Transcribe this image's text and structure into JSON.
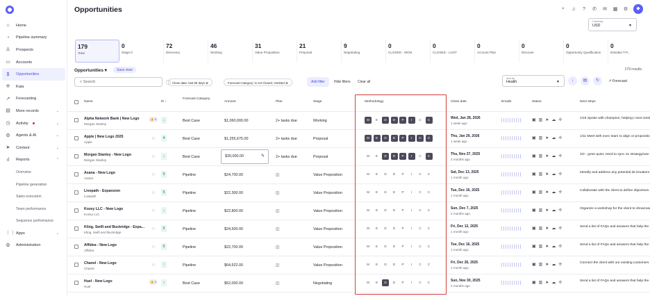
{
  "app": {
    "title": "Opportunities"
  },
  "sidebar": {
    "items": [
      {
        "label": "Home",
        "icon": "home-icon",
        "glyph": "⌂",
        "chev": ""
      },
      {
        "label": "Pipeline summary",
        "icon": "pipeline-icon",
        "glyph": "◔",
        "chev": ""
      },
      {
        "label": "Prospects",
        "icon": "person-icon",
        "glyph": "♙",
        "chev": ""
      },
      {
        "label": "Accounts",
        "icon": "building-icon",
        "glyph": "▭",
        "chev": ""
      },
      {
        "label": "Opportunities",
        "icon": "dollar-icon",
        "glyph": "$",
        "chev": "",
        "active": true
      },
      {
        "label": "Kaia",
        "icon": "kaia-icon",
        "glyph": "✢",
        "chev": ""
      },
      {
        "label": "Forecasting",
        "icon": "trend-icon",
        "glyph": "↗",
        "chev": ""
      },
      {
        "label": "More records",
        "icon": "records-icon",
        "glyph": "▤",
        "chev": "⌄"
      },
      {
        "label": "Activity",
        "icon": "activity-icon",
        "glyph": "◷",
        "chev": "⌄",
        "dot": true
      },
      {
        "label": "Agents & AI",
        "icon": "agents-icon",
        "glyph": "⚙",
        "chev": "⌄"
      },
      {
        "label": "Content",
        "icon": "send-icon",
        "glyph": "➤",
        "chev": "⌄"
      },
      {
        "label": "Reports",
        "icon": "reports-icon",
        "glyph": "ıl",
        "chev": "⌃"
      }
    ],
    "sub_items": [
      "Overview",
      "Pipeline generation",
      "Sales execution",
      "Team performance",
      "Sequence performance"
    ],
    "bottom_items": [
      {
        "label": "Apps",
        "icon": "apps-icon",
        "glyph": "⋮⋮",
        "chev": "⌄"
      },
      {
        "label": "Administration",
        "icon": "admin-gear-icon",
        "glyph": "⚙",
        "chev": ""
      }
    ]
  },
  "currency": {
    "label": "Currency",
    "value": "USD"
  },
  "kpis": [
    {
      "n": "179",
      "l": "Total"
    },
    {
      "n": "0",
      "l": "Stage 0"
    },
    {
      "n": "72",
      "l": "Discovery"
    },
    {
      "n": "46",
      "l": "Working"
    },
    {
      "n": "31",
      "l": "Value Proposition"
    },
    {
      "n": "21",
      "l": "Proposal"
    },
    {
      "n": "9",
      "l": "Negotiating"
    },
    {
      "n": "0",
      "l": "CLOSED - WON"
    },
    {
      "n": "0",
      "l": "CLOSED - LOST"
    },
    {
      "n": "0",
      "l": "Account Plan"
    },
    {
      "n": "0",
      "l": "Discover"
    },
    {
      "n": "0",
      "l": "Opportunity Qualification"
    },
    {
      "n": "0",
      "l": "Detailed T-P..."
    }
  ],
  "toolbar": {
    "opp_label": "Opportunities ▾",
    "save_view": "Save view",
    "results": "179 results",
    "search_placeholder": "Search",
    "chip_date": "Close date: last 90 days ⊗",
    "chip_fc": "Forecast Category: is not Closed, Omitted ⊗",
    "add_filter": "Add filter",
    "hide_filters": "Hide filters",
    "clear_all": "Clear all",
    "sort_label": "Sort by",
    "sort_value": "Healih",
    "forecast": "↗ Forecast"
  },
  "columns": {
    "name": "Name",
    "th": "th ↓",
    "fc": "Forecast Category",
    "amount": "Amount",
    "plan": "Plan",
    "stage": "Stage",
    "meth": "Methodology",
    "close": "Close date",
    "emails": "Emails",
    "status": "Status",
    "next": "Next steps"
  },
  "meth_letters": [
    "M",
    "E",
    "D",
    "D",
    "P",
    "I",
    "C",
    "C"
  ],
  "rows": [
    {
      "name": "Alpha Network Bank | New Logo",
      "acct": "Morgan Stanley",
      "thumb": "👍 4",
      "trend": "↓",
      "fc": "Best Case",
      "amount": "$1,060,000.00",
      "plan": "2+ tasks due",
      "stage": "Working",
      "meth": [
        1,
        0,
        1,
        1,
        1,
        1,
        0,
        1
      ],
      "close": "Wed, Jan 28, 2026",
      "ago": "1 week ago",
      "next": "1/19 Spoke with champion; helping t next meeting to discuss proposal..."
    },
    {
      "name": "Apple | New Logo 2025",
      "acct": "Apple",
      "thumb": "",
      "trend": "4",
      "fc": "Best Case",
      "amount": "$1,255,675.00",
      "plan": "2+ tasks due",
      "stage": "Proposal",
      "meth": [
        1,
        1,
        1,
        1,
        1,
        1,
        1,
        1
      ],
      "close": "Thu, Jan 29, 2026",
      "ago": "1 week ago",
      "next": "1/11 Meet with exec team to align or proposition and discuss contract"
    },
    {
      "name": "Morgan Stanley - New Logo",
      "acct": "Morgan Stanley",
      "thumb": "",
      "trend": "↓",
      "fc": "Best Case",
      "amount": "$30,000.00",
      "plan": "2+ tasks due",
      "stage": "Proposal",
      "meth": [
        0,
        0,
        1,
        1,
        1,
        1,
        0,
        1
      ],
      "close": "Thu, Nov 27, 2025",
      "ago": "2 months ago",
      "next": "4/2 - gone quiet, need to sync on strategy/use plan...",
      "box": true
    },
    {
      "name": "Asana - New Logo",
      "acct": "Asana",
      "thumb": "",
      "trend": "5",
      "fc": "Pipeline",
      "amount": "$24,700.00",
      "plan": "◫",
      "stage": "Value Proposition",
      "meth": [
        0,
        0,
        0,
        0,
        0,
        0,
        0,
        0
      ],
      "close": "Sat, Dec 13, 2025",
      "ago": "1 month ago",
      "next": "Identify and address any potential de breakers upfront. Engage in transpar"
    },
    {
      "name": "Livepath - Expansion",
      "acct": "Livepath",
      "thumb": "",
      "trend": "5",
      "fc": "Pipeline",
      "amount": "$22,300.00",
      "plan": "◫",
      "stage": "Value Proposition",
      "meth": [
        0,
        0,
        0,
        0,
        0,
        0,
        0,
        0
      ],
      "close": "Tue, Dec 16, 2025",
      "ago": "1 month ago",
      "next": "Collaborate with the client to define objectives and KPIs. It sets the stage"
    },
    {
      "name": "Kozey LLC - New Logo",
      "acct": "Kozey LLC",
      "thumb": "",
      "trend": "↓",
      "fc": "Pipeline",
      "amount": "$22,800.00",
      "plan": "◫",
      "stage": "Value Proposition",
      "meth": [
        0,
        0,
        0,
        0,
        0,
        0,
        0,
        0
      ],
      "close": "Sun, Dec 7, 2025",
      "ago": "2 months ago",
      "next": "Organize a workshop for the client to showcase our capabilities. This will"
    },
    {
      "name": "Kling, Swift and Buckridge - Expa...",
      "acct": "Kling, Swift and Buckridge",
      "thumb": "",
      "trend": "5",
      "fc": "Pipeline",
      "amount": "$24,500.00",
      "plan": "◫",
      "stage": "Value Proposition",
      "meth": [
        0,
        0,
        0,
        0,
        0,
        0,
        0,
        0
      ],
      "close": "Fri, Dec 12, 2025",
      "ago": "1 month ago",
      "next": "Send a list of FAQs and answers that help the client. It's an effective way t"
    },
    {
      "name": "Affidea - New Logo",
      "acct": "Affidea",
      "thumb": "",
      "trend": "5",
      "fc": "Pipeline",
      "amount": "$22,700.00",
      "plan": "◫",
      "stage": "Value Proposition",
      "meth": [
        0,
        0,
        0,
        0,
        0,
        0,
        0,
        0
      ],
      "close": "Tue, Dec 16, 2025",
      "ago": "1 month ago",
      "next": "Send a list of FAQs and answers that help the client. It's an effective way t"
    },
    {
      "name": "Chanel - New Logo",
      "acct": "Chanel",
      "thumb": "",
      "trend": "↑",
      "fc": "Pipeline",
      "amount": "$64,522.00",
      "plan": "◫",
      "stage": "Value Proposition",
      "meth": [
        0,
        0,
        0,
        0,
        0,
        0,
        0,
        0
      ],
      "close": "Fri, Dec 26, 2025",
      "ago": "1 month ago",
      "next": "Connect the client with our existing customers for references. This can p"
    },
    {
      "name": "Huel - New Logo",
      "acct": "Huel",
      "thumb": "👍 1",
      "trend": "↑",
      "fc": "Best Case",
      "amount": "$52,000.00",
      "plan": "◫",
      "stage": "Negotiating",
      "meth": [
        0,
        0,
        1,
        0,
        0,
        0,
        0,
        0
      ],
      "close": "Sun, Nov 30, 2025",
      "ago": "2 months ago",
      "next": "Send a list of FAQs and answers that help the client. It's an effective way t"
    }
  ]
}
